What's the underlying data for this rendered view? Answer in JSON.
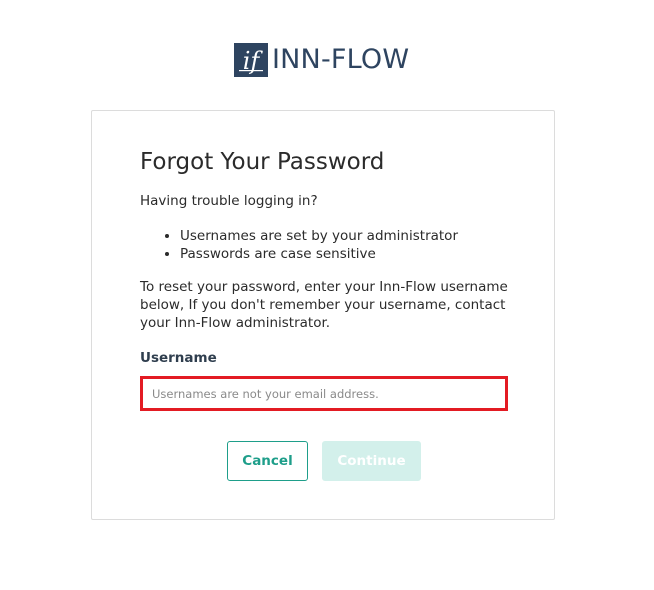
{
  "brand": {
    "logo_mark_text": "if",
    "name": "INN-FLOW",
    "color": "#2e4460"
  },
  "form": {
    "title": "Forgot Your Password",
    "intro": "Having trouble logging in?",
    "bullets": [
      "Usernames are set by your administrator",
      "Passwords are case sensitive"
    ],
    "instructions": "To reset your password, enter your Inn-Flow username below, If you don't remember your username, contact your Inn-Flow administrator.",
    "username_label": "Username",
    "username_value": "",
    "username_placeholder": "Usernames are not your email address.",
    "highlight_color": "#e31b23"
  },
  "actions": {
    "cancel_label": "Cancel",
    "continue_label": "Continue",
    "continue_enabled": false,
    "accent_color": "#1e9e8a"
  }
}
